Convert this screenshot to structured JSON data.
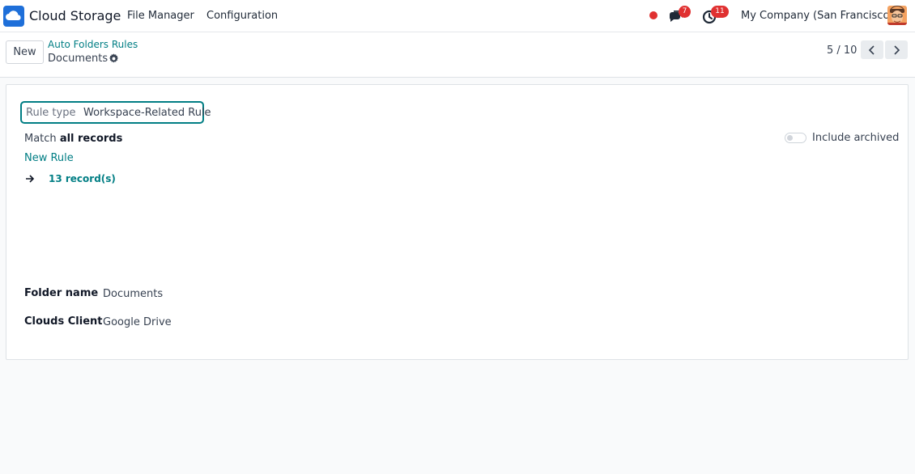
{
  "navbar": {
    "app_title": "Cloud Storage",
    "menu": {
      "file_manager": "File Manager",
      "configuration": "Configuration"
    },
    "messages_badge": "7",
    "activities_badge": "11",
    "company": "My Company (San Francisco)",
    "status_color": "#e03131"
  },
  "control_panel": {
    "new_button": "New",
    "breadcrumb": {
      "parent": "Auto Folders Rules",
      "current": "Documents"
    },
    "pager": "5 / 10"
  },
  "form": {
    "rule_type": {
      "label": "Rule type",
      "value": "Workspace-Related Rule"
    },
    "domain": {
      "match_prefix": "Match",
      "match_bold": "all records",
      "new_rule": "New Rule",
      "records": "13 record(s)"
    },
    "include_archived": {
      "label": "Include archived",
      "enabled": false
    },
    "fields": {
      "folder_name": {
        "label": "Folder name",
        "value": "Documents"
      },
      "clouds_client": {
        "label": "Clouds Client",
        "value": "Google Drive"
      }
    }
  },
  "colors": {
    "accent": "#017e84",
    "badge": "#e03131"
  },
  "icons": {
    "app": "cloud-icon",
    "messages": "chat-icon",
    "activities": "clock-icon",
    "breadcrumb_action": "gear-icon",
    "pager_prev": "chevron-left-icon",
    "pager_next": "chevron-right-icon",
    "records": "arrow-right-icon"
  }
}
